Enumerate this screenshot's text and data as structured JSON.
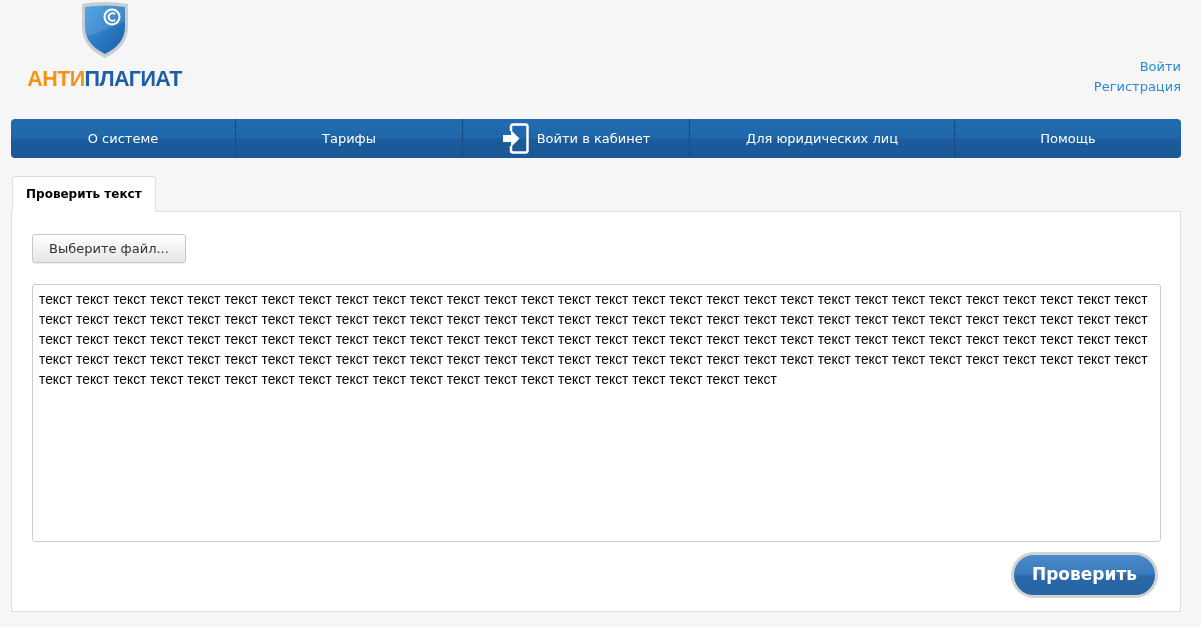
{
  "logo": {
    "wordmark": [
      {
        "text": "АНТИ",
        "color": "#f39419"
      },
      {
        "text": "ПЛАГИАТ",
        "color": "#1d5ea6"
      }
    ]
  },
  "account_links": [
    "Войти",
    "Регистрация"
  ],
  "nav": [
    {
      "label": "О системе",
      "kind": "link"
    },
    {
      "label": "Тарифы",
      "kind": "link"
    },
    {
      "label": "Войти в кабинет",
      "kind": "login"
    },
    {
      "label": "Для юридических лиц",
      "kind": "link"
    },
    {
      "label": "Помощь",
      "kind": "link"
    }
  ],
  "tabs": [
    {
      "label": "Проверить текст",
      "selected": true
    }
  ],
  "file_button": "Выберите файл...",
  "text_field": {
    "value": "текст текст текст текст текст текст текст текст текст текст текст текст текст текст текст текст текст текст текст текст текст текст текст текст текст текст текст текст текст текст текст текст текст текст текст текст текст текст текст текст текст текст текст текст текст текст текст текст текст текст текст текст текст текст текст текст текст текст текст текст текст текст текст текст текст текст текст текст текст текст текст текст текст текст текст текст текст текст текст текст текст текст текст текст текст текст текст текст текст текст текст текст текст текст текст текст текст текст текст текст текст текст текст текст текст текст текст текст текст текст текст текст текст текст текст текст текст текст текст текст текст текст текст текст текст текст текст текст текст текст текст текст текст текст текст текст текст текст текст текст"
  },
  "submit_button": "Проверить"
}
